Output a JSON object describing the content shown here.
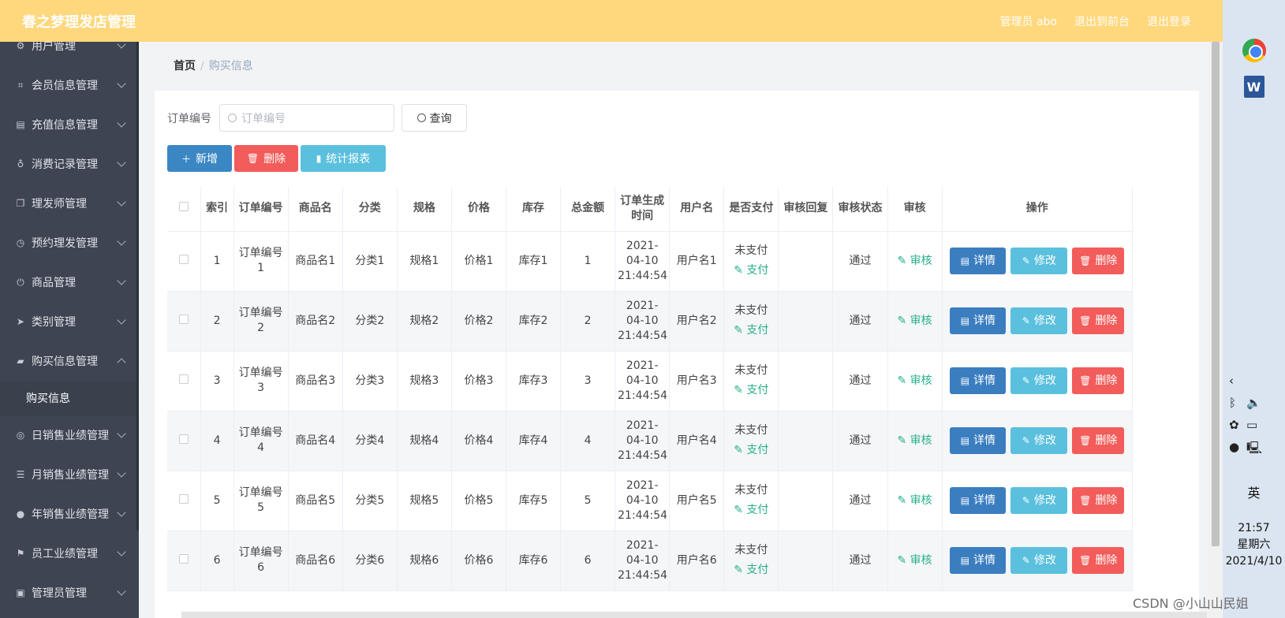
{
  "header": {
    "title": "春之梦理发店管理",
    "links": [
      "管理员 abo",
      "退出到前台",
      "退出登录"
    ]
  },
  "sidebar": {
    "items": [
      {
        "label": "用户管理",
        "icon": "settings-icon"
      },
      {
        "label": "会员信息管理",
        "icon": "crop-icon"
      },
      {
        "label": "充值信息管理",
        "icon": "document-icon"
      },
      {
        "label": "消费记录管理",
        "icon": "microphone-icon"
      },
      {
        "label": "理发师管理",
        "icon": "copy-icon"
      },
      {
        "label": "预约理发管理",
        "icon": "clock-icon"
      },
      {
        "label": "商品管理",
        "icon": "power-icon"
      },
      {
        "label": "类别管理",
        "icon": "send-icon"
      },
      {
        "label": "购买信息管理",
        "icon": "cart-icon",
        "expanded": true
      },
      {
        "label": "日销售业绩管理",
        "icon": "compass-icon"
      },
      {
        "label": "月销售业绩管理",
        "icon": "sliders-icon"
      },
      {
        "label": "年销售业绩管理",
        "icon": "user-icon"
      },
      {
        "label": "员工业绩管理",
        "icon": "flag-icon"
      },
      {
        "label": "管理员管理",
        "icon": "message-icon"
      }
    ],
    "submenu_label": "购买信息"
  },
  "breadcrumb": {
    "home": "首页",
    "separator": "/",
    "current": "购买信息"
  },
  "search": {
    "label": "订单编号",
    "placeholder": "订单编号",
    "button": "查询"
  },
  "toolbar": {
    "add": "新增",
    "delete": "删除",
    "stats": "统计报表"
  },
  "table": {
    "headers": [
      "索引",
      "订单编号",
      "商品名",
      "分类",
      "规格",
      "价格",
      "库存",
      "总金额",
      "订单生成时间",
      "用户名",
      "是否支付",
      "审核回复",
      "审核状态",
      "审核",
      "操作"
    ],
    "pay_link": "支付",
    "audit_link": "审核",
    "row_buttons": {
      "detail": "详情",
      "edit": "修改",
      "delete": "删除"
    },
    "rows": [
      {
        "index": "1",
        "order": "订单编号1",
        "product": "商品名1",
        "category": "分类1",
        "spec": "规格1",
        "price": "价格1",
        "stock": "库存1",
        "total": "1",
        "time": "2021-04-10 21:44:54",
        "user": "用户名1",
        "paid": "未支付",
        "reply": "",
        "status": "通过"
      },
      {
        "index": "2",
        "order": "订单编号2",
        "product": "商品名2",
        "category": "分类2",
        "spec": "规格2",
        "price": "价格2",
        "stock": "库存2",
        "total": "2",
        "time": "2021-04-10 21:44:54",
        "user": "用户名2",
        "paid": "未支付",
        "reply": "",
        "status": "通过"
      },
      {
        "index": "3",
        "order": "订单编号3",
        "product": "商品名3",
        "category": "分类3",
        "spec": "规格3",
        "price": "价格3",
        "stock": "库存3",
        "total": "3",
        "time": "2021-04-10 21:44:54",
        "user": "用户名3",
        "paid": "未支付",
        "reply": "",
        "status": "通过"
      },
      {
        "index": "4",
        "order": "订单编号4",
        "product": "商品名4",
        "category": "分类4",
        "spec": "规格4",
        "price": "价格4",
        "stock": "库存4",
        "total": "4",
        "time": "2021-04-10 21:44:54",
        "user": "用户名4",
        "paid": "未支付",
        "reply": "",
        "status": "通过"
      },
      {
        "index": "5",
        "order": "订单编号5",
        "product": "商品名5",
        "category": "分类5",
        "spec": "规格5",
        "price": "价格5",
        "stock": "库存5",
        "total": "5",
        "time": "2021-04-10 21:44:54",
        "user": "用户名5",
        "paid": "未支付",
        "reply": "",
        "status": "通过"
      },
      {
        "index": "6",
        "order": "订单编号6",
        "product": "商品名6",
        "category": "分类6",
        "spec": "规格6",
        "price": "价格6",
        "stock": "库存6",
        "total": "6",
        "time": "2021-04-10 21:44:54",
        "user": "用户名6",
        "paid": "未支付",
        "reply": "",
        "status": "通过"
      }
    ]
  },
  "taskbar": {
    "lang": "英",
    "time": "21:57",
    "weekday": "星期六",
    "date": "2021/4/10"
  },
  "watermark": "CSDN @小山山民姐",
  "colors": {
    "header": "#ffd77c",
    "sidebar": "#3e4451",
    "primary": "#3b87c4",
    "danger": "#f25c5a",
    "info": "#5bc0de",
    "success_text": "#27b08a"
  }
}
